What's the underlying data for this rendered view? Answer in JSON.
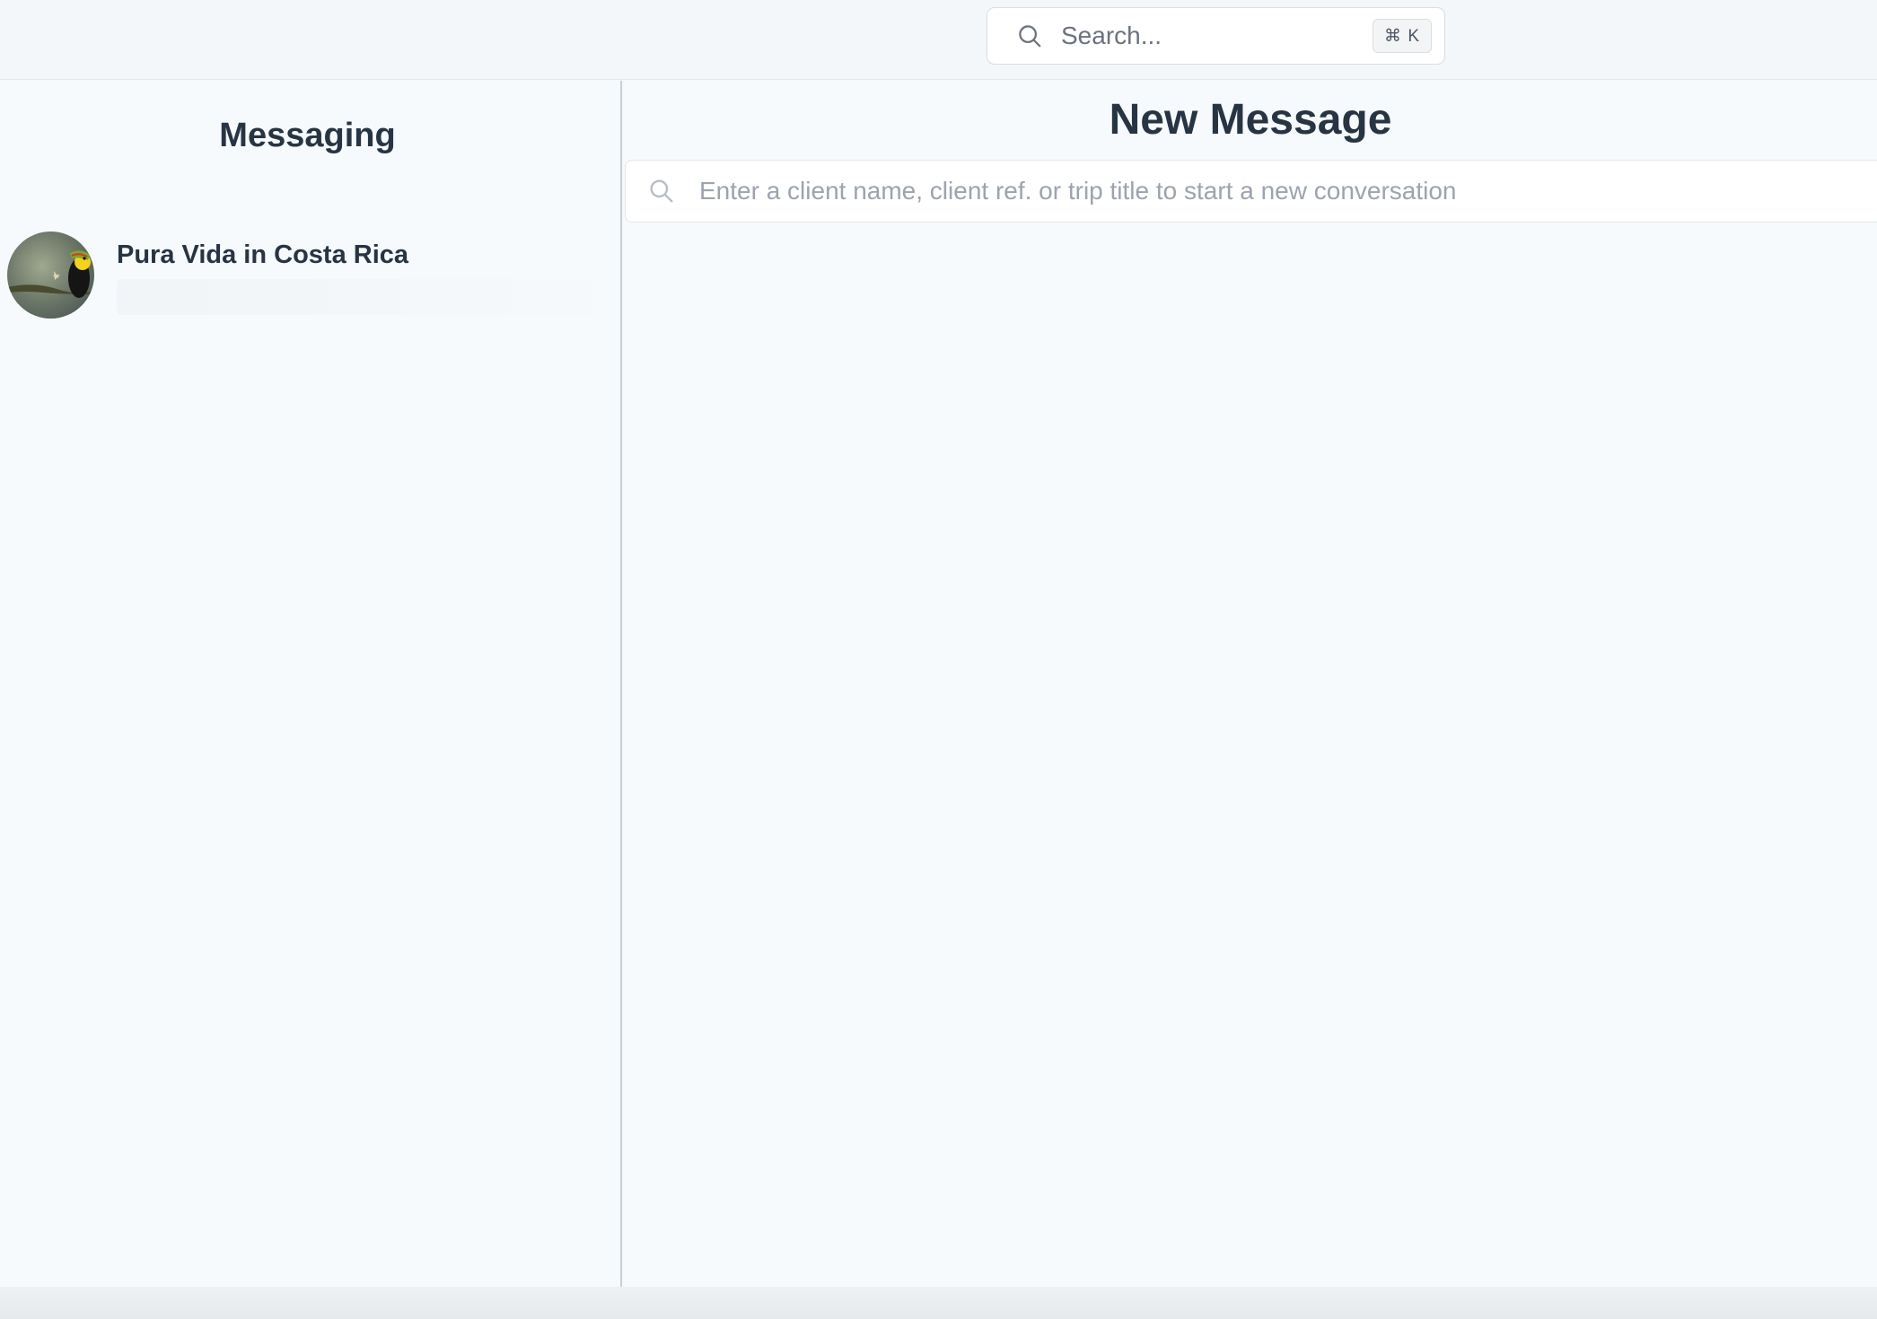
{
  "topbar": {
    "search": {
      "placeholder": "Search...",
      "shortcut": "⌘ K",
      "icon": "search-icon"
    }
  },
  "sidebar": {
    "title": "Messaging",
    "conversations": [
      {
        "title": "Pura Vida in Costa Rica",
        "avatar": "toucan-photo"
      }
    ]
  },
  "main": {
    "title": "New Message",
    "recipient_search": {
      "placeholder": "Enter a client name, client ref. or trip title to start a new conversation",
      "value": "",
      "icon": "search-icon"
    }
  },
  "colors": {
    "background": "#f6f9fb",
    "heading": "#273444",
    "placeholder": "#9ca3af",
    "divider": "#c9cfd5"
  }
}
